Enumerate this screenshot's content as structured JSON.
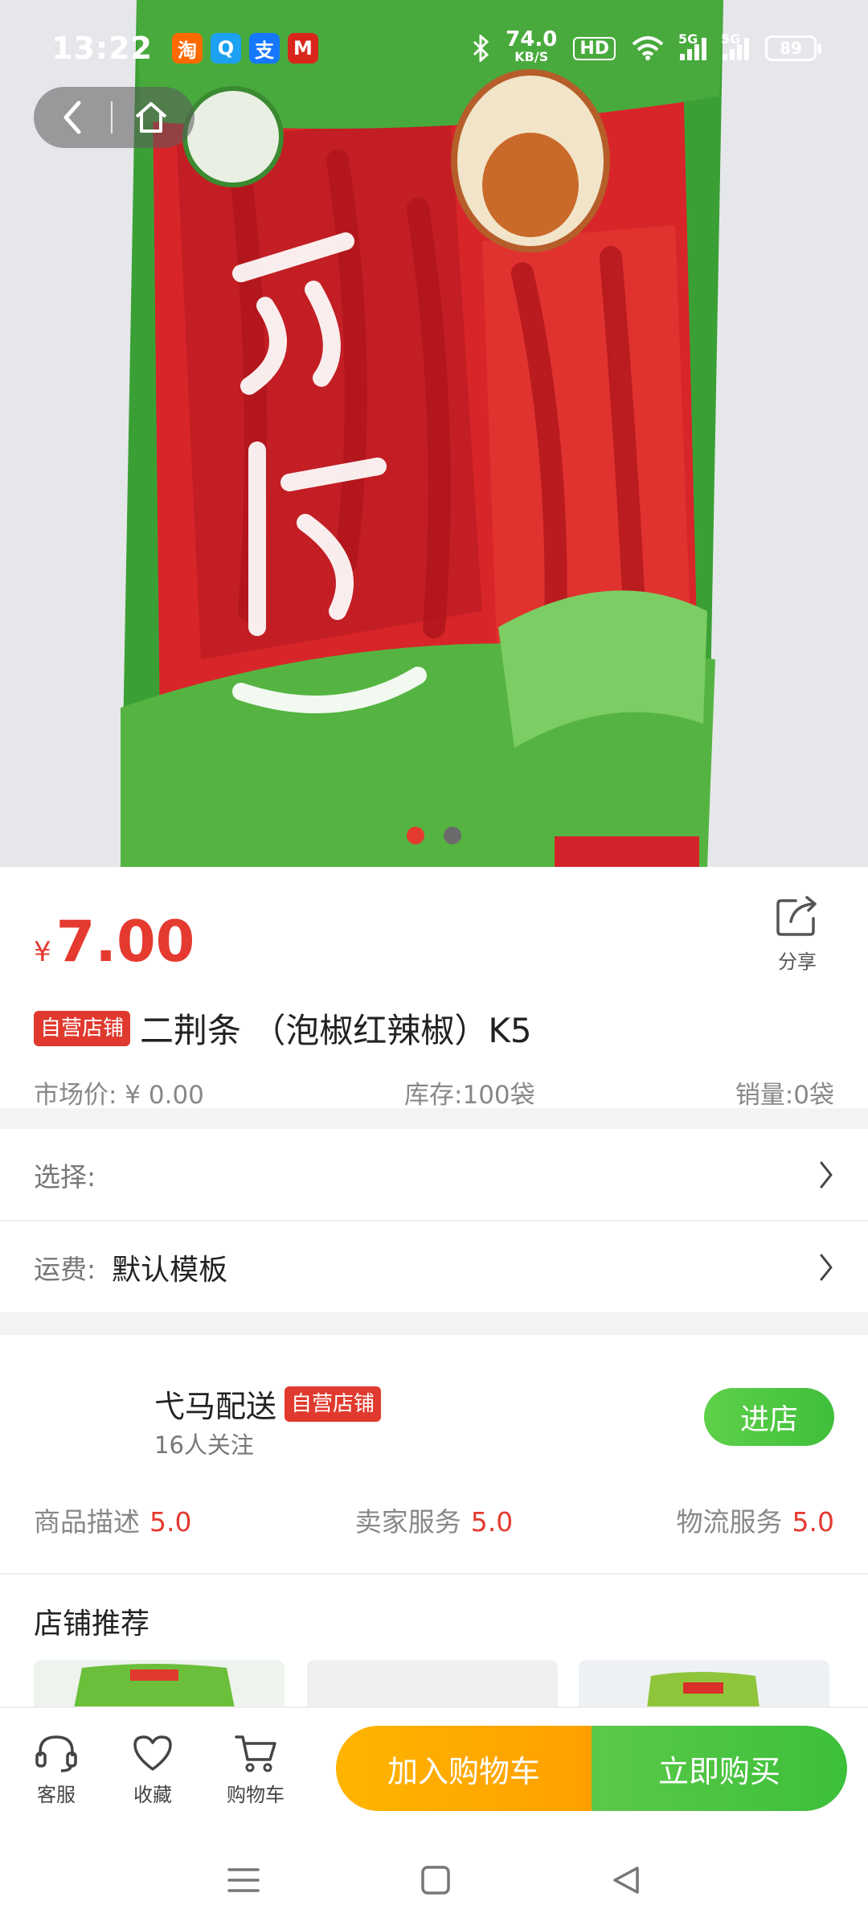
{
  "status_bar": {
    "time": "13:22",
    "apps": [
      {
        "icon": "taobao-icon",
        "glyph": "淘",
        "color": "#ff6a00"
      },
      {
        "icon": "qq-icon",
        "glyph": "Q",
        "color": "#1da1f2"
      },
      {
        "icon": "alipay-icon",
        "glyph": "支",
        "color": "#1677ff"
      },
      {
        "icon": "bank-icon",
        "glyph": "M",
        "color": "#d9261c"
      }
    ],
    "net_speed": "74.0",
    "net_unit": "KB/S",
    "hd": "HD",
    "sig1": "5G",
    "sig2": "5G",
    "battery": "89"
  },
  "carousel": {
    "count": 2,
    "active": 0
  },
  "product": {
    "currency": "¥",
    "price": "7.00",
    "share_label": "分享",
    "tag": "自营店铺",
    "title": "二荆条 （泡椒红辣椒）K5",
    "market_price": "市场价: ¥ 0.00",
    "stock": "库存:100袋",
    "sales": "销量:0袋"
  },
  "options": {
    "select_label": "选择:",
    "shipping_label": "运费:",
    "shipping_value": "默认模板"
  },
  "store": {
    "name": "弋马配送",
    "tag": "自营店铺",
    "followers": "16人关注",
    "enter_label": "进店",
    "ratings": [
      {
        "label": "商品描述",
        "score": "5.0"
      },
      {
        "label": "卖家服务",
        "score": "5.0"
      },
      {
        "label": "物流服务",
        "score": "5.0"
      }
    ]
  },
  "recommend": {
    "title": "店铺推荐"
  },
  "bottom": {
    "service_label": "客服",
    "favorite_label": "收藏",
    "cart_label": "购物车",
    "add_cart_label": "加入购物车",
    "buy_now_label": "立即购买"
  },
  "colors": {
    "accent_red": "#e53a2f",
    "accent_green": "#4cc444",
    "accent_orange": "#ffab00"
  }
}
